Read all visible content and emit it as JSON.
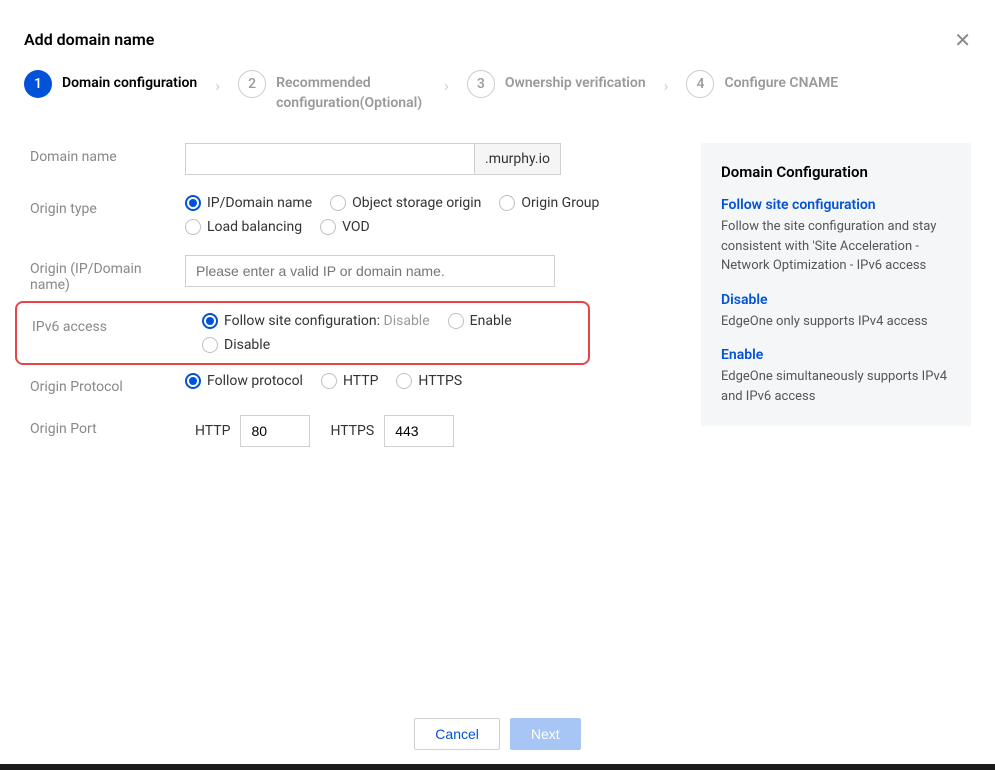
{
  "header": {
    "title": "Add domain name"
  },
  "steps": [
    {
      "num": "1",
      "label": "Domain configuration",
      "active": true
    },
    {
      "num": "2",
      "label": "Recommended configuration(Optional)",
      "active": false
    },
    {
      "num": "3",
      "label": "Ownership verification",
      "active": false
    },
    {
      "num": "4",
      "label": "Configure CNAME",
      "active": false
    }
  ],
  "form": {
    "domain_name_label": "Domain name",
    "domain_name_value": "",
    "domain_suffix": ".murphy.io",
    "origin_type_label": "Origin type",
    "origin_type_options": {
      "ip_domain": "IP/Domain name",
      "object_storage": "Object storage origin",
      "origin_group": "Origin Group",
      "load_balancing": "Load balancing",
      "vod": "VOD"
    },
    "origin_label": "Origin (IP/Domain name)",
    "origin_placeholder": "Please enter a valid IP or domain name.",
    "origin_value": "",
    "ipv6_label": "IPv6 access",
    "ipv6_options": {
      "follow_prefix": "Follow site configuration: ",
      "follow_suffix": "Disable",
      "enable": "Enable",
      "disable": "Disable"
    },
    "protocol_label": "Origin Protocol",
    "protocol_options": {
      "follow": "Follow protocol",
      "http": "HTTP",
      "https": "HTTPS"
    },
    "port_label": "Origin Port",
    "port_http_label": "HTTP",
    "port_http_value": "80",
    "port_https_label": "HTTPS",
    "port_https_value": "443"
  },
  "side": {
    "title": "Domain Configuration",
    "blocks": [
      {
        "title": "Follow site configuration",
        "text": "Follow the site configuration and stay consistent with 'Site Acceleration - Network Optimization - IPv6 access"
      },
      {
        "title": "Disable",
        "text": "EdgeOne only supports IPv4 access"
      },
      {
        "title": "Enable",
        "text": "EdgeOne simultaneously supports IPv4 and IPv6 access"
      }
    ]
  },
  "footer": {
    "cancel": "Cancel",
    "next": "Next"
  }
}
